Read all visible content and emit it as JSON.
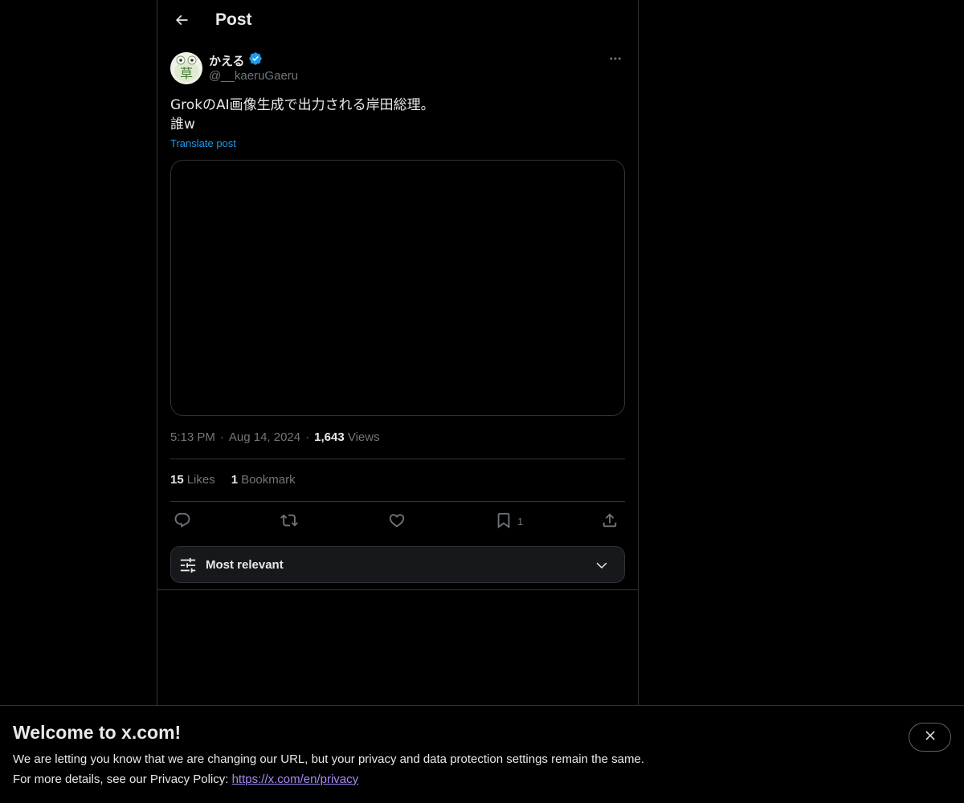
{
  "header": {
    "title": "Post"
  },
  "author": {
    "display_name": "かえる",
    "handle": "@__kaeruGaeru",
    "avatar_char": "草"
  },
  "post": {
    "text_line_1": "GrokのAI画像生成で出力される岸田総理。",
    "text_line_2": "誰w",
    "translate_label": "Translate post"
  },
  "meta": {
    "time": "5:13 PM",
    "date": "Aug 14, 2024",
    "views_count": "1,643",
    "views_label": "Views",
    "separator": "·"
  },
  "stats": {
    "likes_count": "15",
    "likes_label": "Likes",
    "bookmarks_count": "1",
    "bookmarks_label": "Bookmark"
  },
  "actions": {
    "bookmark_count": "1"
  },
  "sort": {
    "label": "Most relevant"
  },
  "banner": {
    "title": "Welcome to x.com!",
    "line_1": "We are letting you know that we are changing our URL, but your privacy and data protection settings remain the same.",
    "line_2_prefix": "For more details, see our Privacy Policy: ",
    "link_text": "https://x.com/en/privacy"
  },
  "colors": {
    "background": "#000000",
    "text": "#e7e9ea",
    "muted": "#71767b",
    "accent": "#1d9bf0",
    "border": "#2f3336",
    "link": "#a78bfa"
  },
  "icons": {
    "back": "arrow-left-icon",
    "verified": "verified-badge-icon",
    "more": "more-horizontal-icon",
    "reply": "reply-icon",
    "repost": "repost-icon",
    "like": "heart-icon",
    "bookmark": "bookmark-icon",
    "share": "share-icon",
    "sort": "sliders-icon",
    "chevron": "chevron-down-icon",
    "close": "close-icon"
  }
}
